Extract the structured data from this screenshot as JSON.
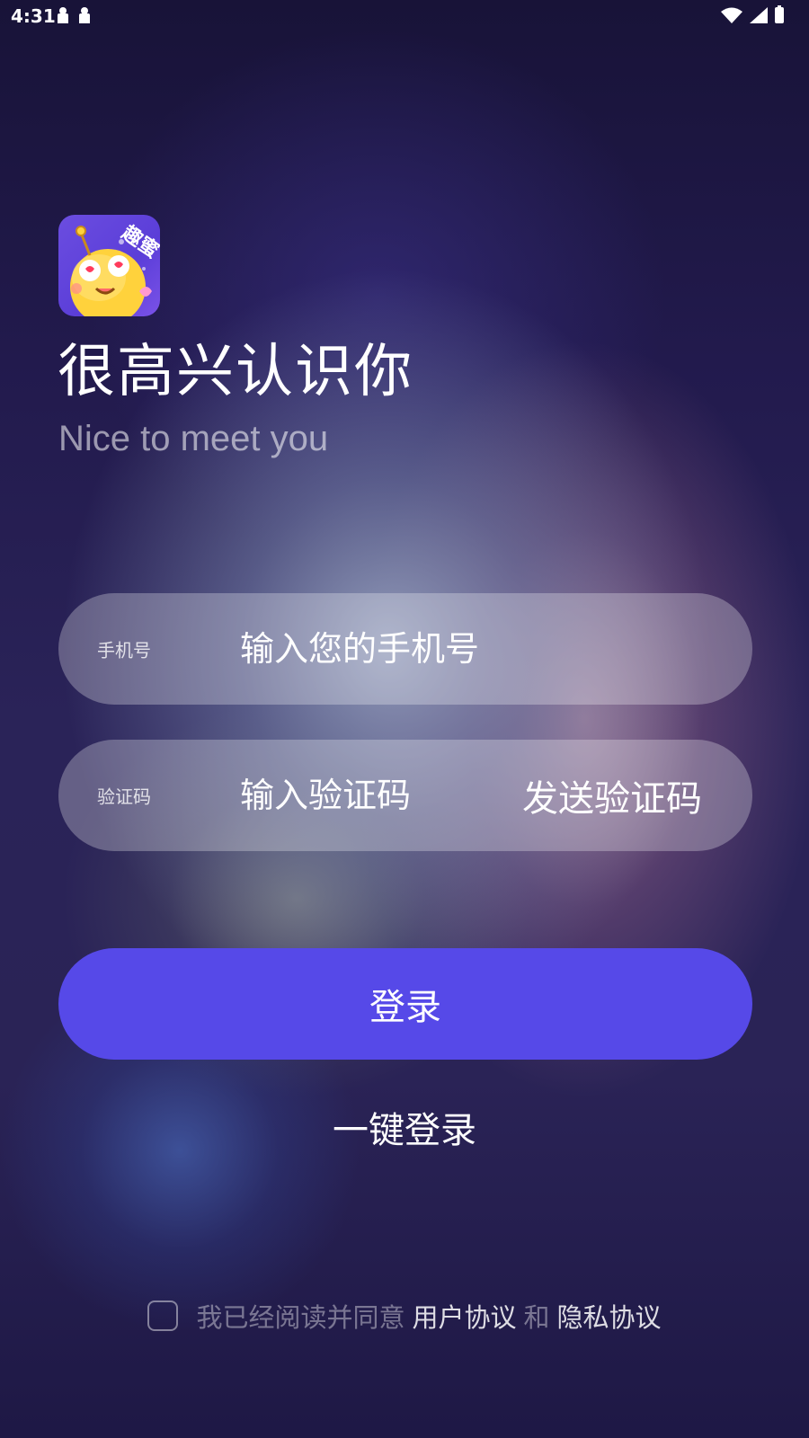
{
  "status_bar": {
    "time": "4:31",
    "left_icons": [
      "notification-icon",
      "notification-icon"
    ],
    "right_icons": [
      "wifi-icon",
      "signal-icon",
      "battery-charging-icon"
    ]
  },
  "app": {
    "logo_icon": "app-logo-icon",
    "logo_text": "趣蜜"
  },
  "hero": {
    "title": "很高兴认识你",
    "subtitle": "Nice to meet you"
  },
  "phone_field": {
    "label": "手机号",
    "placeholder": "输入您的手机号",
    "value": ""
  },
  "code_field": {
    "label": "验证码",
    "placeholder": "输入验证码",
    "value": "",
    "send_label": "发送验证码"
  },
  "login_button": {
    "label": "登录"
  },
  "one_click_login": {
    "label": "一键登录"
  },
  "agreement": {
    "checked": false,
    "prefix": "我已经阅读并同意",
    "user_agreement": "用户协议",
    "conjunction": "和",
    "privacy_agreement": "隐私协议"
  },
  "colors": {
    "primary_button": "#5649e8",
    "background_dark": "#1e1845"
  }
}
